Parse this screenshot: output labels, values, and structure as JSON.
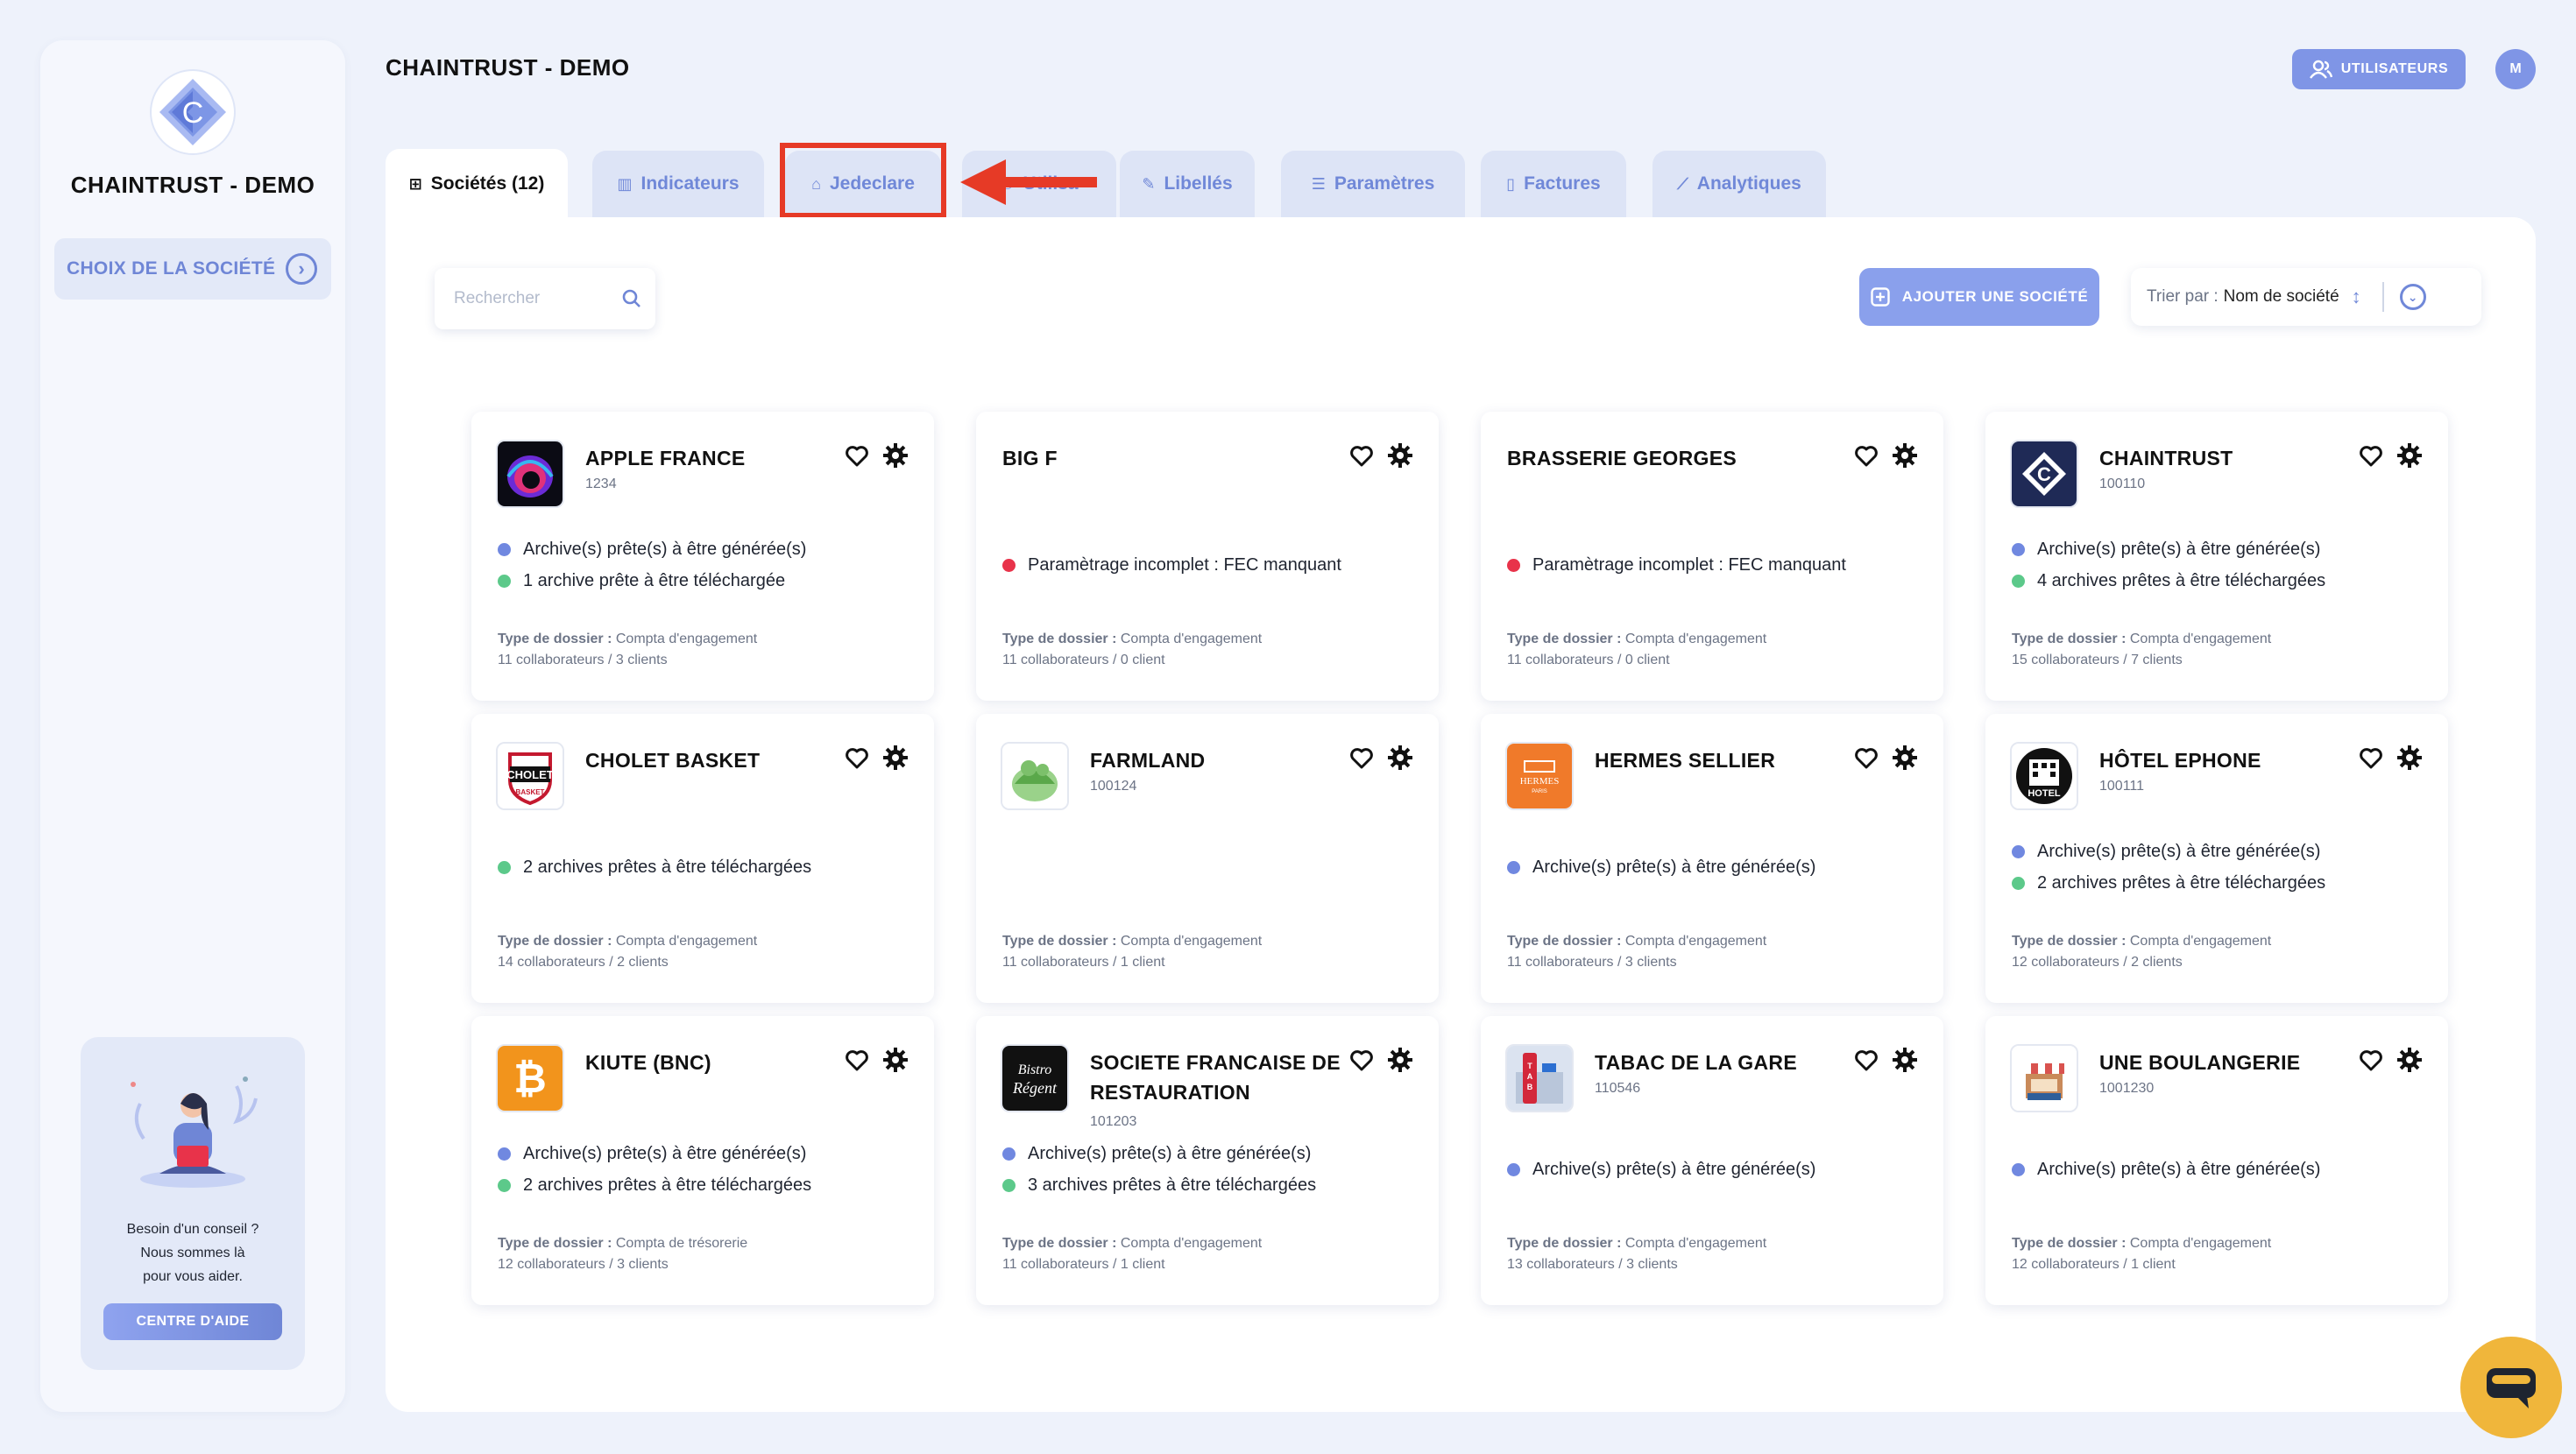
{
  "sidebar": {
    "brand": "CHAINTRUST - DEMO",
    "choice_label": "CHOIX DE LA SOCIÉTÉ",
    "help_lines": [
      "Besoin d'un conseil ?",
      "Nous sommes là",
      "pour vous aider."
    ],
    "help_button": "CENTRE D'AIDE"
  },
  "header": {
    "title": "CHAINTRUST - DEMO",
    "users_button": "UTILISATEURS",
    "avatar_initial": "M"
  },
  "tabs": [
    {
      "label": "Sociétés (12)",
      "icon": "grid-icon"
    },
    {
      "label": "Indicateurs",
      "icon": "bar-chart-icon"
    },
    {
      "label": "Jedeclare",
      "icon": "bank-icon"
    },
    {
      "label": "Utilisa",
      "icon": "users-icon"
    },
    {
      "label": "Libellés",
      "icon": "pencil-icon"
    },
    {
      "label": "Paramètres",
      "icon": "sliders-icon"
    },
    {
      "label": "Factures",
      "icon": "file-icon"
    },
    {
      "label": "Analytiques",
      "icon": "line-chart-icon"
    }
  ],
  "toolbar": {
    "search_placeholder": "Rechercher",
    "add_button": "AJOUTER UNE SOCIÉTÉ",
    "sort_prefix": "Trier par :",
    "sort_value": "Nom de société"
  },
  "labels": {
    "type_prefix": "Type de dossier :"
  },
  "companies": [
    {
      "name": "APPLE FRANCE",
      "code": "1234",
      "logo": "apple-logo",
      "statuses": [
        {
          "color": "blue",
          "text": "Archive(s) prête(s) à être générée(s)"
        },
        {
          "color": "green",
          "text": "1 archive prête à être téléchargée"
        }
      ],
      "type": "Compta d'engagement",
      "team": "11 collaborateurs / 3 clients"
    },
    {
      "name": "BIG F",
      "code": "",
      "logo": "",
      "statuses": [
        {
          "color": "red",
          "text": "Paramètrage incomplet : FEC manquant"
        }
      ],
      "type": "Compta d'engagement",
      "team": "11 collaborateurs / 0 client"
    },
    {
      "name": "BRASSERIE GEORGES",
      "code": "",
      "logo": "",
      "statuses": [
        {
          "color": "red",
          "text": "Paramètrage incomplet : FEC manquant"
        }
      ],
      "type": "Compta d'engagement",
      "team": "11 collaborateurs / 0 client"
    },
    {
      "name": "CHAINTRUST",
      "code": "100110",
      "logo": "chaintrust-logo",
      "statuses": [
        {
          "color": "blue",
          "text": "Archive(s) prête(s) à être générée(s)"
        },
        {
          "color": "green",
          "text": "4 archives prêtes à être téléchargées"
        }
      ],
      "type": "Compta d'engagement",
      "team": "15 collaborateurs / 7 clients"
    },
    {
      "name": "CHOLET BASKET",
      "code": "",
      "logo": "cholet-logo",
      "statuses": [
        {
          "color": "green",
          "text": "2 archives prêtes à être téléchargées"
        }
      ],
      "type": "Compta d'engagement",
      "team": "14 collaborateurs / 2 clients"
    },
    {
      "name": "FARMLAND",
      "code": "100124",
      "logo": "farmland-logo",
      "statuses": [],
      "type": "Compta d'engagement",
      "team": "11 collaborateurs / 1 client"
    },
    {
      "name": "HERMES SELLIER",
      "code": "",
      "logo": "hermes-logo",
      "statuses": [
        {
          "color": "blue",
          "text": "Archive(s) prête(s) à être générée(s)"
        }
      ],
      "type": "Compta d'engagement",
      "team": "11 collaborateurs / 3 clients"
    },
    {
      "name": "HÔTEL EPHONE",
      "code": "100111",
      "logo": "hotel-logo",
      "statuses": [
        {
          "color": "blue",
          "text": "Archive(s) prête(s) à être générée(s)"
        },
        {
          "color": "green",
          "text": "2 archives prêtes à être téléchargées"
        }
      ],
      "type": "Compta d'engagement",
      "team": "12 collaborateurs / 2 clients"
    },
    {
      "name": "KIUTE (BNC)",
      "code": "",
      "logo": "bitcoin-logo",
      "statuses": [
        {
          "color": "blue",
          "text": "Archive(s) prête(s) à être générée(s)"
        },
        {
          "color": "green",
          "text": "2 archives prêtes à être téléchargées"
        }
      ],
      "type": "Compta de trésorerie",
      "team": "12 collaborateurs / 3 clients"
    },
    {
      "name": "SOCIETE FRANCAISE DE RESTAURATION",
      "code": "101203",
      "logo": "bistro-logo",
      "statuses": [
        {
          "color": "blue",
          "text": "Archive(s) prête(s) à être générée(s)"
        },
        {
          "color": "green",
          "text": "3 archives prêtes à être téléchargées"
        }
      ],
      "type": "Compta d'engagement",
      "team": "11 collaborateurs / 1 client"
    },
    {
      "name": "TABAC DE LA GARE",
      "code": "110546",
      "logo": "tabac-logo",
      "statuses": [
        {
          "color": "blue",
          "text": "Archive(s) prête(s) à être générée(s)"
        }
      ],
      "type": "Compta d'engagement",
      "team": "13 collaborateurs / 3 clients"
    },
    {
      "name": "UNE BOULANGERIE",
      "code": "1001230",
      "logo": "bakery-logo",
      "statuses": [
        {
          "color": "blue",
          "text": "Archive(s) prête(s) à être générée(s)"
        }
      ],
      "type": "Compta d'engagement",
      "team": "12 collaborateurs / 1 client"
    }
  ],
  "colors": {
    "accent": "#7088d8",
    "status_blue": "#7088e0",
    "status_green": "#5cc98a",
    "status_red": "#e8334a",
    "highlight_red": "#e63a26"
  }
}
